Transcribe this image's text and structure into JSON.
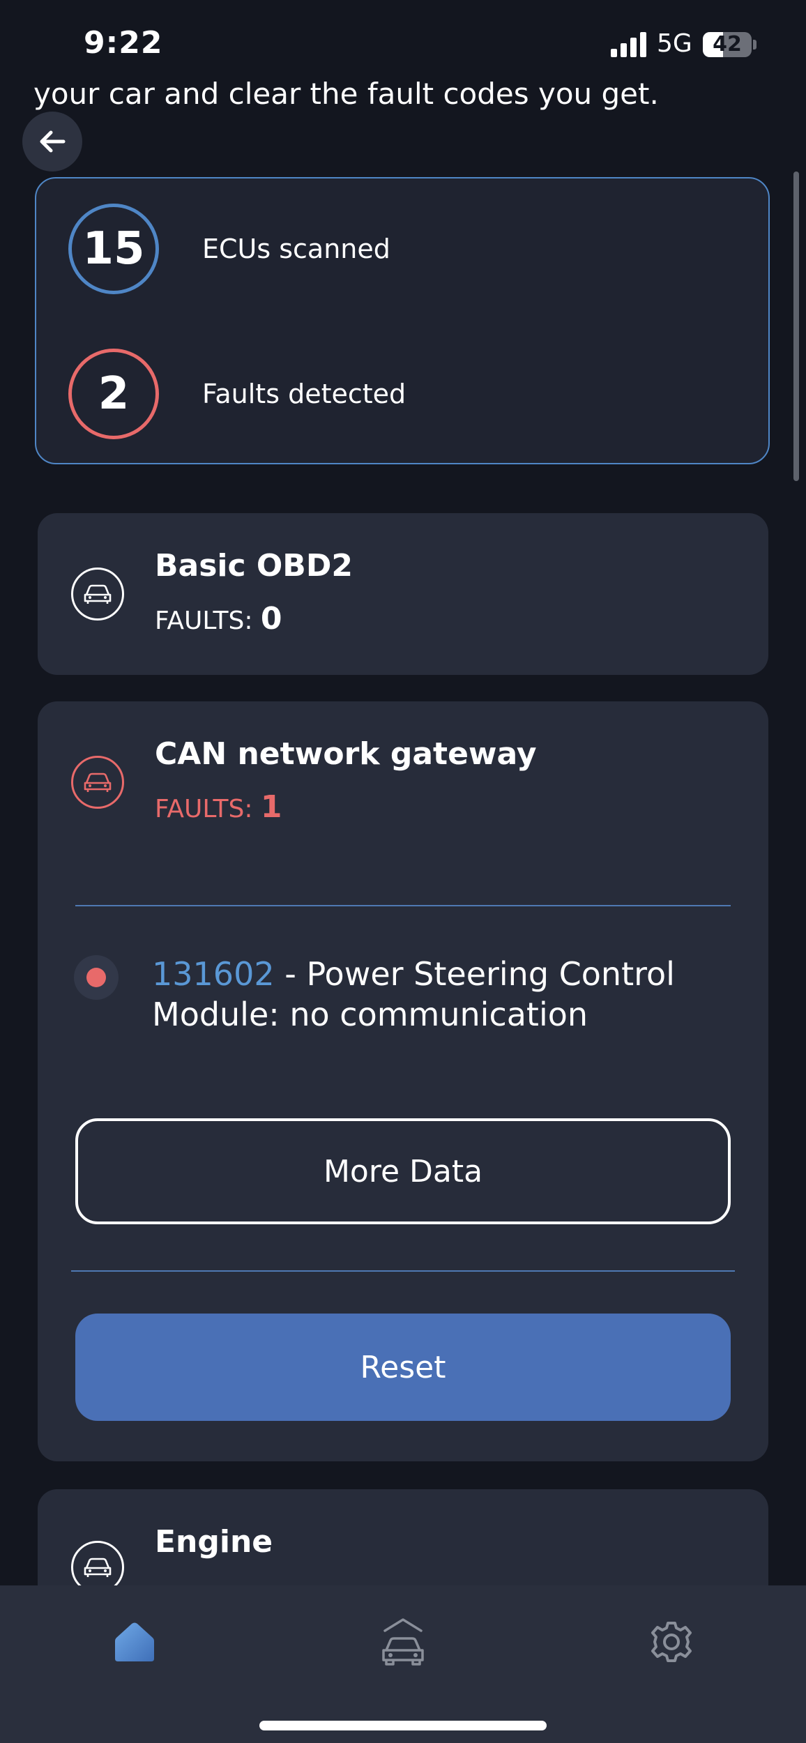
{
  "status_bar": {
    "time": "9:22",
    "network": "5G",
    "battery": "42",
    "battery_level": 0.42
  },
  "intro": {
    "text": "your car and clear the fault codes you get."
  },
  "summary": {
    "ecus_count": "15",
    "ecus_label": "ECUs scanned",
    "faults_count": "2",
    "faults_label": "Faults detected"
  },
  "ecus": [
    {
      "title": "Basic OBD2",
      "faults_label": "FAULTS:",
      "faults_count": "0"
    },
    {
      "title": "CAN network gateway",
      "faults_label": "FAULTS:",
      "faults_count": "1",
      "fault": {
        "code": "131602",
        "description": " - Power Steering Control Module: no communication"
      },
      "more_label": "More Data",
      "reset_label": "Reset"
    },
    {
      "title": "Engine"
    }
  ],
  "nav": {
    "items": [
      "home-icon",
      "car-icon",
      "settings-icon"
    ]
  },
  "colors": {
    "accent_blue": "#4f86c6",
    "fault_red": "#e86a6a",
    "reset_blue": "#4a70b6"
  }
}
